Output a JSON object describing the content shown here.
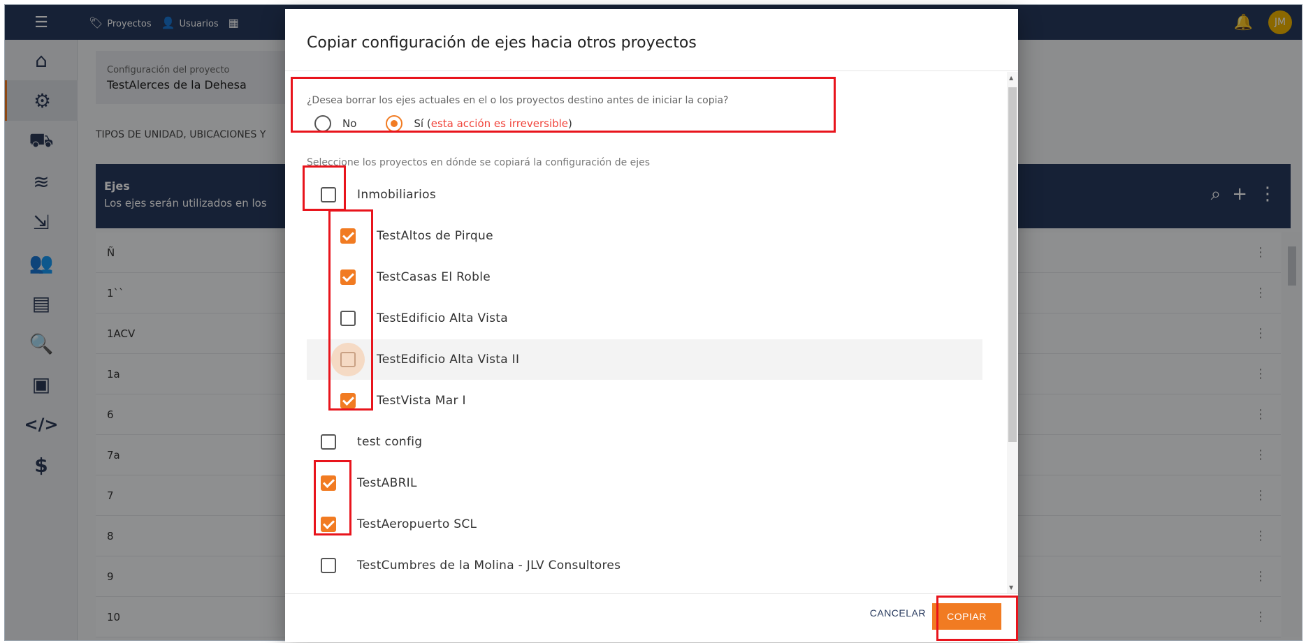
{
  "topbar": {
    "menu_icon": "hamburger-icon",
    "links": [
      {
        "icon": "tags-icon",
        "label": "Proyectos"
      },
      {
        "icon": "user-icon",
        "label": "Usuarios"
      }
    ],
    "avatar_initials": "JM"
  },
  "sidebar": {
    "icons": [
      "home-icon",
      "settings-icon",
      "wheelbarrow-icon",
      "layers-icon",
      "export-icon",
      "team-icon",
      "blueprint-icon",
      "inspection-icon",
      "safe-icon",
      "code-icon",
      "dollar-icon"
    ]
  },
  "page": {
    "config_label": "Configuración del proyecto",
    "config_value": "TestAlerces de la Dehesa",
    "section_title": "TIPOS DE UNIDAD, UBICACIONES Y",
    "ejes_title": "Ejes",
    "ejes_subtitle": "Los ejes serán utilizados en los",
    "rows": [
      "Ñ",
      "1``",
      "1ACV",
      "1a",
      "6",
      "7a",
      "7",
      "8",
      "9",
      "10"
    ]
  },
  "dialog": {
    "title": "Copiar configuración de ejes hacia otros proyectos",
    "question": "¿Desea borrar los ejes actuales en el o los proyectos destino antes de iniciar la copia?",
    "option_no": "No",
    "option_si": "Sí (",
    "option_si_warning": "esta acción es irreversible",
    "option_si_close": ")",
    "selected_option": "Sí",
    "helper": "Seleccione los proyectos en dónde se copiará la configuración de ejes",
    "projects": [
      {
        "label": "Inmobiliarios",
        "checked": false,
        "child": false
      },
      {
        "label": "TestAltos de Pirque",
        "checked": true,
        "child": true
      },
      {
        "label": "TestCasas El Roble",
        "checked": true,
        "child": true
      },
      {
        "label": "TestEdificio Alta Vista",
        "checked": false,
        "child": true
      },
      {
        "label": "TestEdificio Alta Vista II",
        "checked": false,
        "child": true,
        "hover": true
      },
      {
        "label": "TestVista Mar I",
        "checked": true,
        "child": true
      },
      {
        "label": "test config",
        "checked": false,
        "child": false
      },
      {
        "label": "TestABRIL",
        "checked": true,
        "child": false
      },
      {
        "label": "TestAeropuerto SCL",
        "checked": true,
        "child": false
      },
      {
        "label": "TestCumbres de la Molina - JLV Consultores",
        "checked": false,
        "child": false
      }
    ],
    "cancel_label": "CANCELAR",
    "copy_label": "COPIAR"
  },
  "colors": {
    "navy": "#27395d",
    "accent": "#f17b22",
    "annotation": "#e8141c",
    "warning": "#f0433a"
  }
}
